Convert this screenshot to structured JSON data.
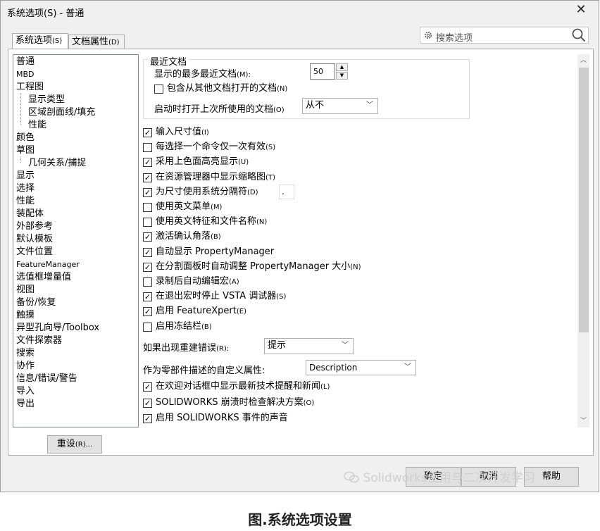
{
  "window": {
    "title": "系统选项(S) - 普通",
    "close_glyph": "✕"
  },
  "tabs": [
    {
      "label": "系统选项",
      "hotkey": "(S)"
    },
    {
      "label": "文档属性",
      "hotkey": "(D)"
    }
  ],
  "search": {
    "placeholder": "搜索选项"
  },
  "tree": {
    "items": [
      {
        "label": "普通"
      },
      {
        "label": "MBD"
      },
      {
        "label": "工程图"
      },
      {
        "label": "显示类型"
      },
      {
        "label": "区域剖面线/填充"
      },
      {
        "label": "性能"
      },
      {
        "label": "颜色"
      },
      {
        "label": "草图"
      },
      {
        "label": "几何关系/捕捉"
      },
      {
        "label": "显示"
      },
      {
        "label": "选择"
      },
      {
        "label": "性能"
      },
      {
        "label": "装配体"
      },
      {
        "label": "外部参考"
      },
      {
        "label": "默认模板"
      },
      {
        "label": "文件位置"
      },
      {
        "label": "FeatureManager"
      },
      {
        "label": "选值框增量值"
      },
      {
        "label": "视图"
      },
      {
        "label": "备份/恢复"
      },
      {
        "label": "触摸"
      },
      {
        "label": "异型孔向导/Toolbox"
      },
      {
        "label": "文件探索器"
      },
      {
        "label": "搜索"
      },
      {
        "label": "协作"
      },
      {
        "label": "信息/错误/警告"
      },
      {
        "label": "导入"
      },
      {
        "label": "导出"
      }
    ]
  },
  "reset_button": {
    "label": "重设",
    "hotkey": "(R)..."
  },
  "recent": {
    "group_title": "最近文档",
    "max_label": "显示的最多最近文档",
    "max_hotkey": "(M):",
    "max_value": "50",
    "include_label": "包含从其他文档打开的文档",
    "include_hotkey": "(N)",
    "include_checked": false,
    "open_last_label": "启动时打开上次所使用的文档",
    "open_last_hotkey": "(O)",
    "open_last_value": "从不"
  },
  "options": [
    {
      "label": "输入尺寸值",
      "hotkey": "(I)",
      "checked": true
    },
    {
      "label": "每选择一个命令仅一次有效",
      "hotkey": "(S)",
      "checked": false
    },
    {
      "label": "采用上色面高亮显示",
      "hotkey": "(U)",
      "checked": true
    },
    {
      "label": "在资源管理器中显示缩略图",
      "hotkey": "(T)",
      "checked": true
    },
    {
      "label": "为尺寸使用系统分隔符",
      "hotkey": "(D)",
      "checked": true
    },
    {
      "label": "使用英文菜单",
      "hotkey": "(M)",
      "checked": false
    },
    {
      "label": "使用英文特征和文件名称",
      "hotkey": "(N)",
      "checked": false
    },
    {
      "label": "激活确认角落",
      "hotkey": "(B)",
      "checked": true
    },
    {
      "label": "自动显示 PropertyManager",
      "hotkey": "",
      "checked": true
    },
    {
      "label": "在分割面板时自动调整 PropertyManager 大小",
      "hotkey": "(N)",
      "checked": true
    },
    {
      "label": "录制后自动编辑宏",
      "hotkey": "(A)",
      "checked": false
    },
    {
      "label": "在退出宏时停止 VSTA 调试器",
      "hotkey": "(S)",
      "checked": true
    },
    {
      "label": "启用 FeatureXpert",
      "hotkey": "(E)",
      "checked": true
    },
    {
      "label": "启用冻结栏",
      "hotkey": "(B)",
      "checked": false
    }
  ],
  "separator_value": ".",
  "rebuild_error": {
    "label": "如果出现重建错误",
    "hotkey": "(R):",
    "value": "提示"
  },
  "custom_prop": {
    "label": "作为零部件描述的自定义属性:",
    "value": "Description"
  },
  "options2": [
    {
      "label": "在欢迎对话框中显示最新技术提醒和新闻",
      "hotkey": "(L)",
      "checked": true
    },
    {
      "label": "SOLIDWORKS 崩溃时检查解决方案",
      "hotkey": "(O)",
      "checked": true
    },
    {
      "label": "启用 SOLIDWORKS 事件的声音",
      "hotkey": "",
      "checked": true
    }
  ],
  "footer": {
    "ok_label": "确定",
    "cancel_label": "取消",
    "help_label": "帮助"
  },
  "watermark": "Solidworks使用与二次开发学习",
  "caption": "图.系统选项设置"
}
